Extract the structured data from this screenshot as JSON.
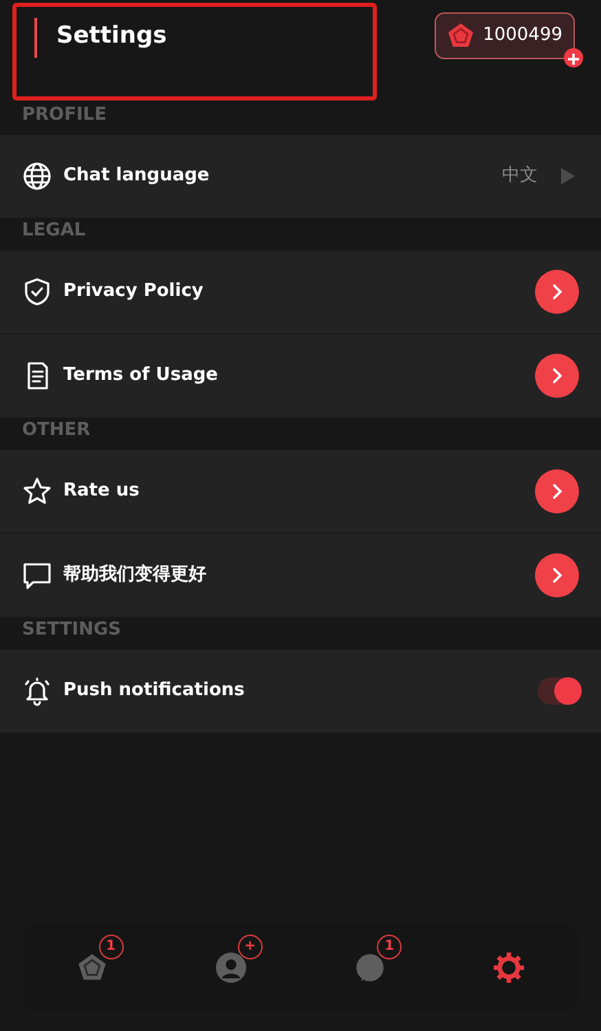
{
  "header": {
    "title": "Settings",
    "coins": "1000499"
  },
  "sections": [
    {
      "title": "PROFILE",
      "items": [
        {
          "kind": "value",
          "label": "Chat language",
          "value": "中文"
        }
      ]
    },
    {
      "title": "LEGAL",
      "items": [
        {
          "kind": "link",
          "label": "Privacy Policy"
        },
        {
          "kind": "link",
          "label": "Terms of Usage"
        }
      ]
    },
    {
      "title": "OTHER",
      "items": [
        {
          "kind": "link",
          "label": "Rate us"
        },
        {
          "kind": "link",
          "label": "帮助我们变得更好"
        }
      ]
    },
    {
      "title": "SETTINGS",
      "items": [
        {
          "kind": "toggle",
          "label": "Push notifications",
          "on": true
        }
      ]
    }
  ],
  "tab_bar": [
    {
      "badge": "1",
      "selected": false
    },
    {
      "badge": "+",
      "selected": false
    },
    {
      "badge": "1",
      "selected": false
    },
    {
      "selected": true
    }
  ]
}
